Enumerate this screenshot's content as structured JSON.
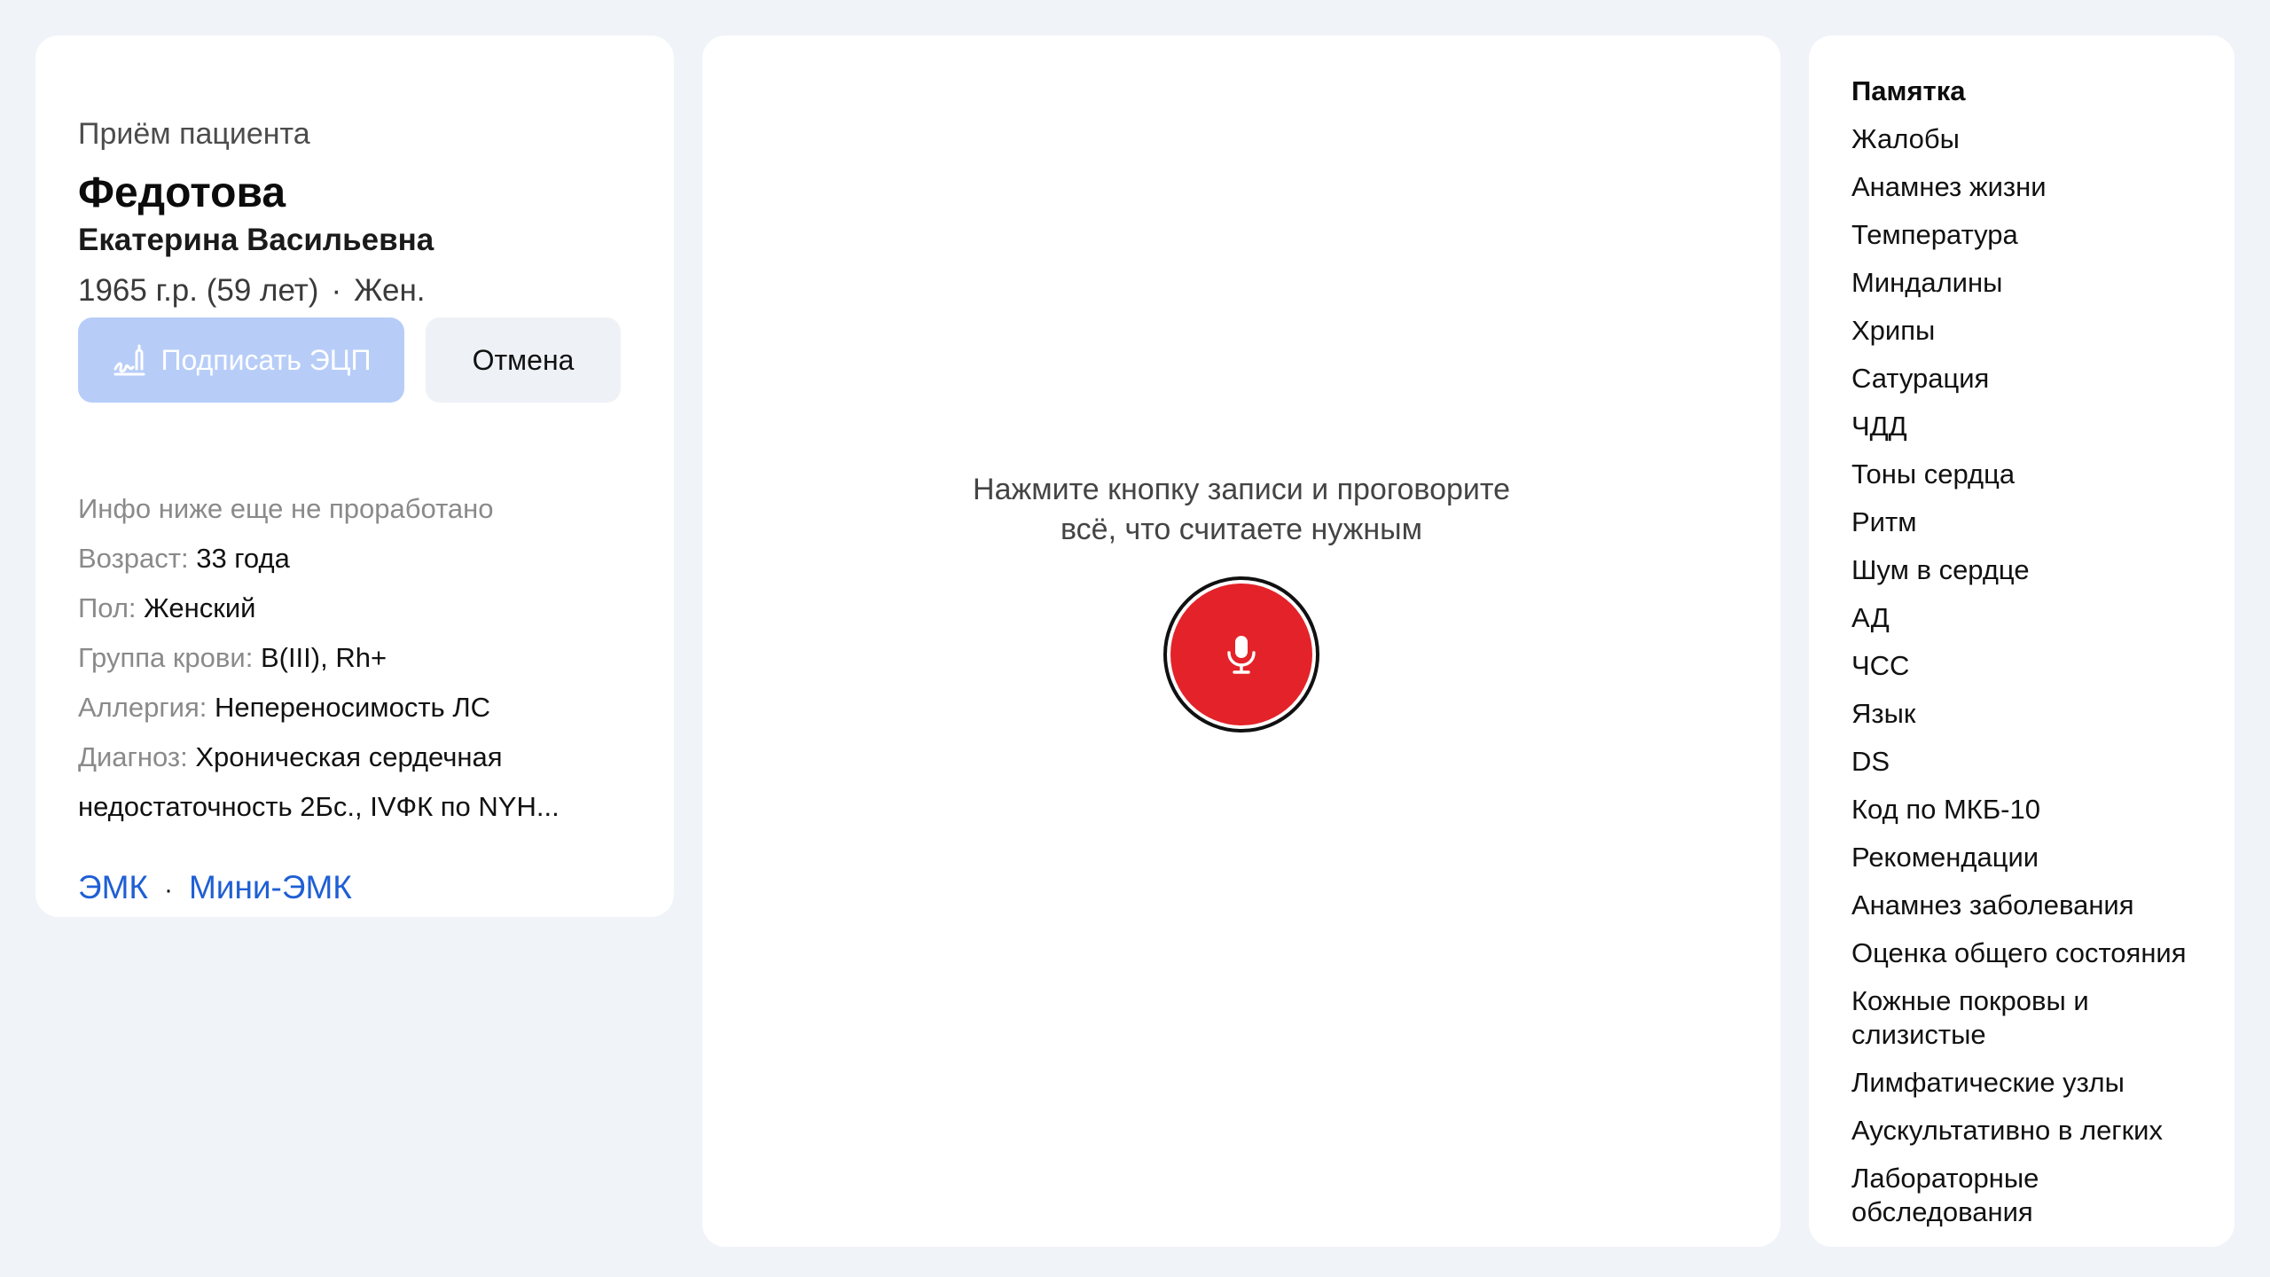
{
  "patient": {
    "visit_title": "Приём пациента",
    "surname": "Федотова",
    "given_names": "Екатерина Васильевна",
    "birth_year": "1965 г.р. (59 лет)",
    "separator": "·",
    "sex_short": "Жен."
  },
  "actions": {
    "sign_label": "Подписать ЭЦП",
    "cancel_label": "Отмена"
  },
  "info": {
    "note": "Инфо ниже еще не проработано",
    "rows": [
      {
        "label": "Возраст:",
        "value": "33 года"
      },
      {
        "label": "Пол:",
        "value": "Женский"
      },
      {
        "label": "Группа крови:",
        "value": "B(III), Rh+"
      },
      {
        "label": "Аллергия:",
        "value": "Непереносимость ЛС"
      },
      {
        "label": "Диагноз:",
        "value": "Хроническая сердечная недостаточность 2Бс., IVФК по NYH..."
      }
    ]
  },
  "links": {
    "emk": "ЭМК",
    "separator": "·",
    "mini_emk": "Мини-ЭМК"
  },
  "recorder": {
    "hint_line1": "Нажмите кнопку записи и проговорите",
    "hint_line2": "всё, что считаете нужным",
    "mic_icon": "microphone-icon",
    "accent_color": "#e32329"
  },
  "memo": {
    "title": "Памятка",
    "items": [
      "Жалобы",
      "Анамнез жизни",
      "Температура",
      "Миндалины",
      "Хрипы",
      "Сатурация",
      "ЧДД",
      "Тоны сердца",
      "Ритм",
      "Шум в сердце",
      "АД",
      "ЧСС",
      "Язык",
      "DS",
      "Код по МКБ-10",
      "Рекомендации",
      "Анамнез заболевания",
      "Оценка общего состояния",
      "Кожные покровы и слизистые",
      "Лимфатические узлы",
      "Аускультативно в легких",
      "Лабораторные обследования"
    ]
  }
}
